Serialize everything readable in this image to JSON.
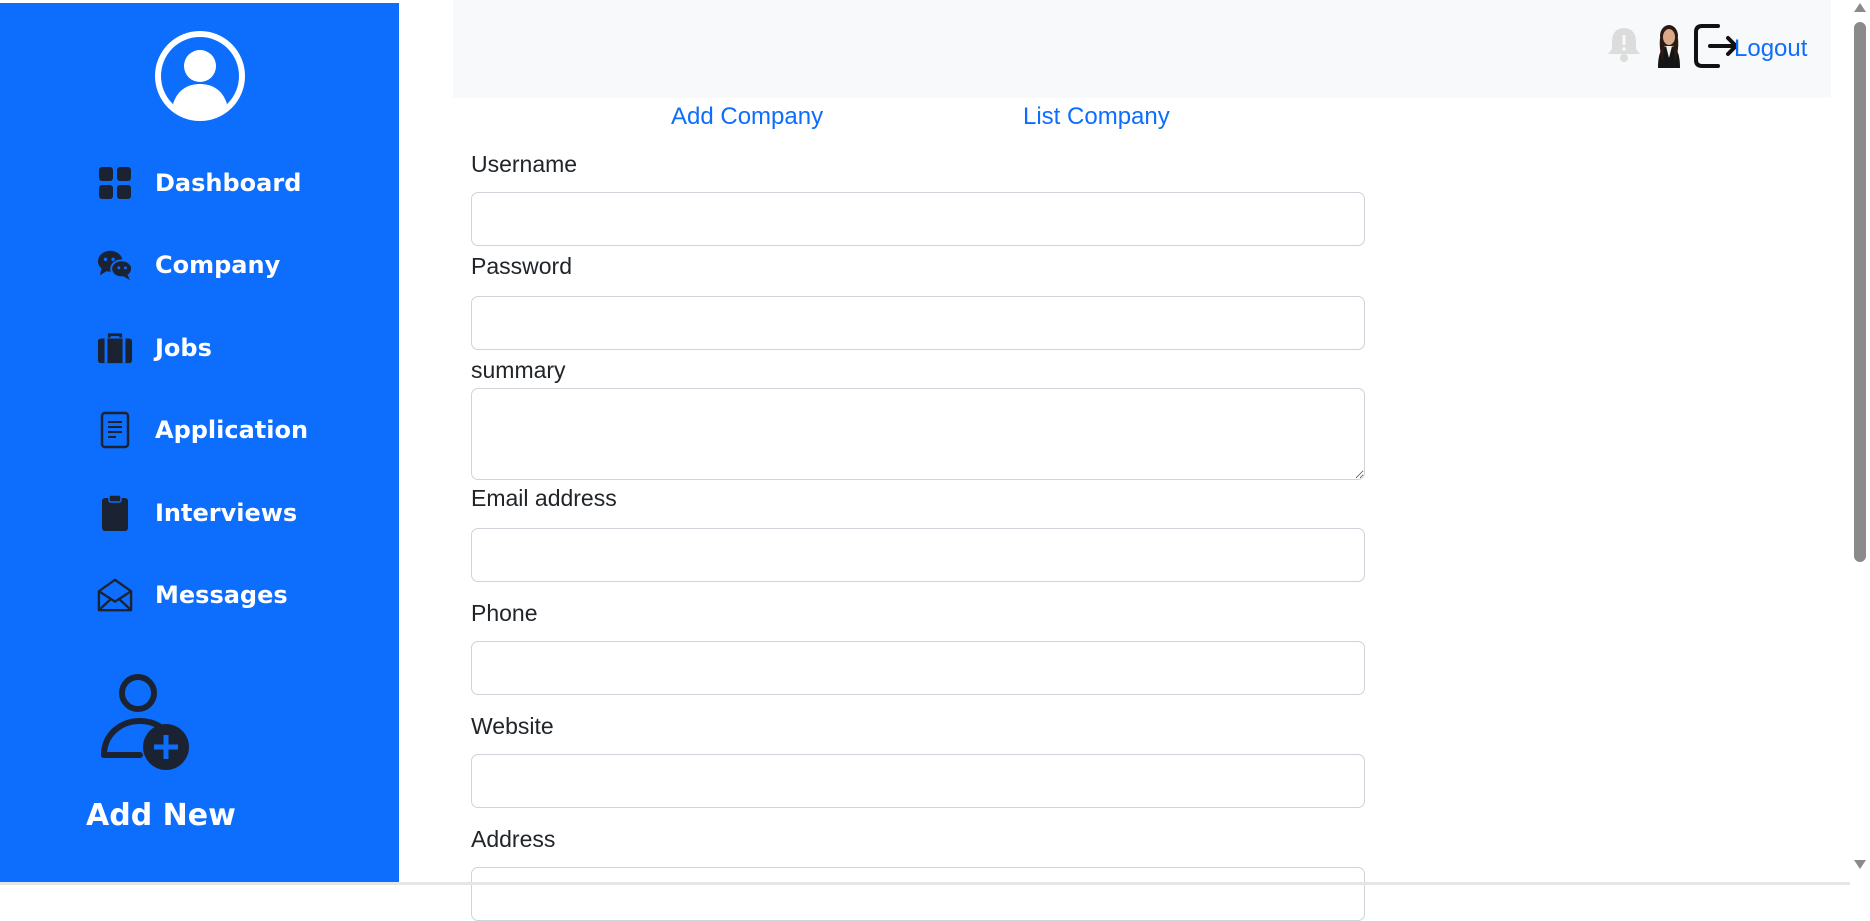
{
  "sidebar": {
    "items": [
      {
        "label": "Dashboard",
        "icon": "grid-icon"
      },
      {
        "label": "Company",
        "icon": "chat-bubbles-icon"
      },
      {
        "label": "Jobs",
        "icon": "briefcase-icon"
      },
      {
        "label": "Application",
        "icon": "document-icon"
      },
      {
        "label": "Interviews",
        "icon": "clipboard-icon"
      },
      {
        "label": "Messages",
        "icon": "envelope-open-icon"
      }
    ],
    "add_new_label": "Add New",
    "colors": {
      "background": "#0d6efd",
      "text": "#ffffff",
      "icon": "#1b2333"
    }
  },
  "header": {
    "logout_label": "Logout",
    "background": "#f8f9fa"
  },
  "subnav": {
    "add_company": "Add Company",
    "list_company": "List Company",
    "link_color": "#0d6efd"
  },
  "form": {
    "fields": [
      {
        "label": "Username",
        "value": "",
        "placeholder": ""
      },
      {
        "label": "Password",
        "value": "",
        "placeholder": ""
      },
      {
        "label": "summary",
        "value": "",
        "placeholder": ""
      },
      {
        "label": "Email address",
        "value": "",
        "placeholder": ""
      },
      {
        "label": "Phone",
        "value": "",
        "placeholder": ""
      },
      {
        "label": "Website",
        "value": "",
        "placeholder": ""
      },
      {
        "label": "Address",
        "value": "",
        "placeholder": ""
      }
    ]
  }
}
